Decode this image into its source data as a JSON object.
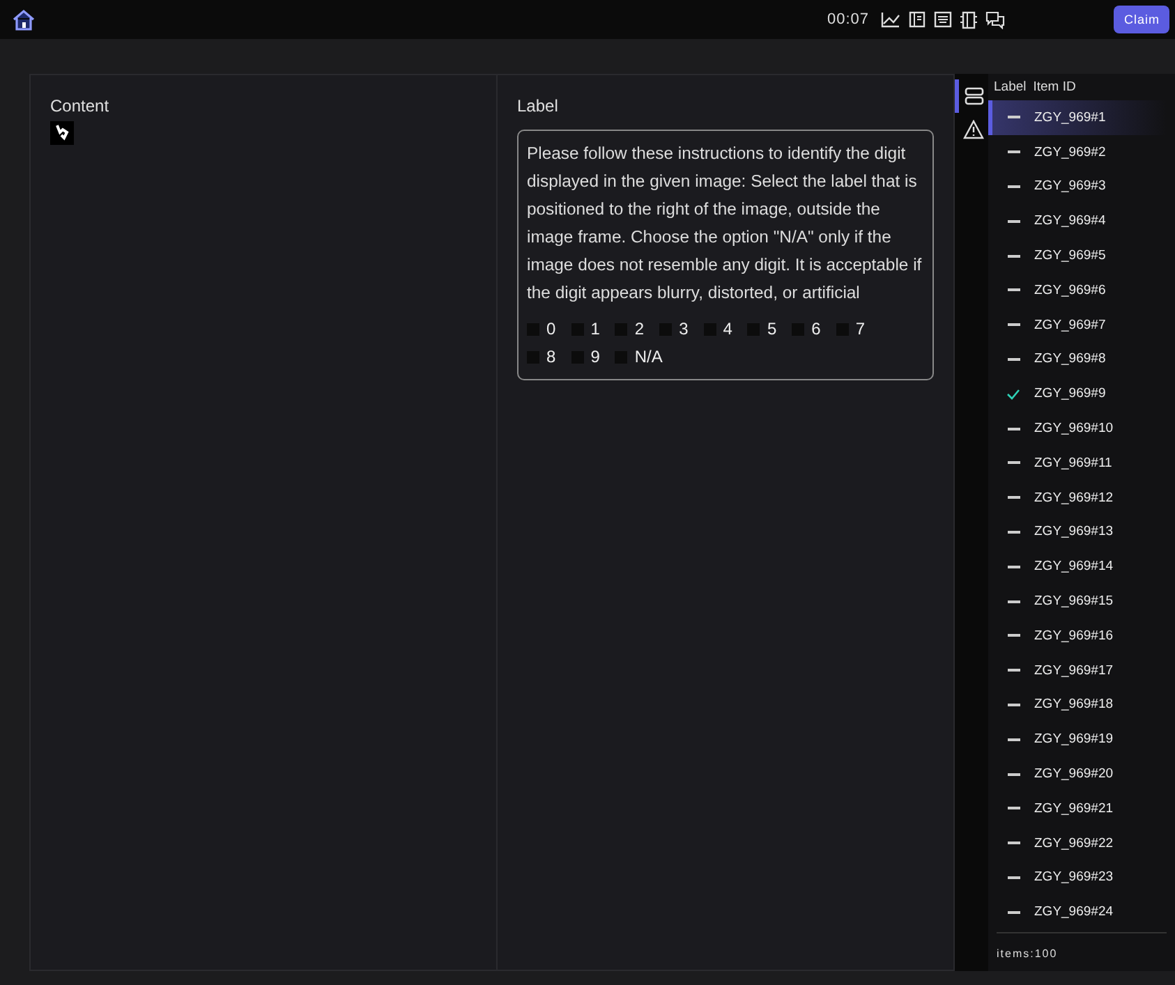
{
  "topbar": {
    "timer": "00:07",
    "claim_button": "Claim"
  },
  "content": {
    "title": "Content"
  },
  "label": {
    "title": "Label",
    "instructions": "Please follow these instructions to identify the digit displayed in the given image: Select the label that is positioned to the right of the image, outside the image frame. Choose the option \"N/A\" only if the image does not resemble any digit. It is acceptable if the digit appears blurry, distorted, or artificial",
    "options": [
      {
        "label": "0",
        "checked": false
      },
      {
        "label": "1",
        "checked": false
      },
      {
        "label": "2",
        "checked": false
      },
      {
        "label": "3",
        "checked": false
      },
      {
        "label": "4",
        "checked": false
      },
      {
        "label": "5",
        "checked": false
      },
      {
        "label": "6",
        "checked": false
      },
      {
        "label": "7",
        "checked": false
      },
      {
        "label": "8",
        "checked": false
      },
      {
        "label": "9",
        "checked": false
      },
      {
        "label": "N/A",
        "checked": false
      }
    ]
  },
  "side_tabs": [
    {
      "kind": "list",
      "selected": true
    },
    {
      "kind": "warning",
      "selected": false
    }
  ],
  "item_list": {
    "columns": [
      "Label",
      "Item ID"
    ],
    "rows": [
      {
        "id": "ZGY_969#1",
        "labeled": false,
        "selected": true
      },
      {
        "id": "ZGY_969#2",
        "labeled": false,
        "selected": false
      },
      {
        "id": "ZGY_969#3",
        "labeled": false,
        "selected": false
      },
      {
        "id": "ZGY_969#4",
        "labeled": false,
        "selected": false
      },
      {
        "id": "ZGY_969#5",
        "labeled": false,
        "selected": false
      },
      {
        "id": "ZGY_969#6",
        "labeled": false,
        "selected": false
      },
      {
        "id": "ZGY_969#7",
        "labeled": false,
        "selected": false
      },
      {
        "id": "ZGY_969#8",
        "labeled": false,
        "selected": false
      },
      {
        "id": "ZGY_969#9",
        "labeled": true,
        "selected": false
      },
      {
        "id": "ZGY_969#10",
        "labeled": false,
        "selected": false
      },
      {
        "id": "ZGY_969#11",
        "labeled": false,
        "selected": false
      },
      {
        "id": "ZGY_969#12",
        "labeled": false,
        "selected": false
      },
      {
        "id": "ZGY_969#13",
        "labeled": false,
        "selected": false
      },
      {
        "id": "ZGY_969#14",
        "labeled": false,
        "selected": false
      },
      {
        "id": "ZGY_969#15",
        "labeled": false,
        "selected": false
      },
      {
        "id": "ZGY_969#16",
        "labeled": false,
        "selected": false
      },
      {
        "id": "ZGY_969#17",
        "labeled": false,
        "selected": false
      },
      {
        "id": "ZGY_969#18",
        "labeled": false,
        "selected": false
      },
      {
        "id": "ZGY_969#19",
        "labeled": false,
        "selected": false
      },
      {
        "id": "ZGY_969#20",
        "labeled": false,
        "selected": false
      },
      {
        "id": "ZGY_969#21",
        "labeled": false,
        "selected": false
      },
      {
        "id": "ZGY_969#22",
        "labeled": false,
        "selected": false
      },
      {
        "id": "ZGY_969#23",
        "labeled": false,
        "selected": false
      },
      {
        "id": "ZGY_969#24",
        "labeled": false,
        "selected": false
      }
    ],
    "footer": "items:100"
  }
}
